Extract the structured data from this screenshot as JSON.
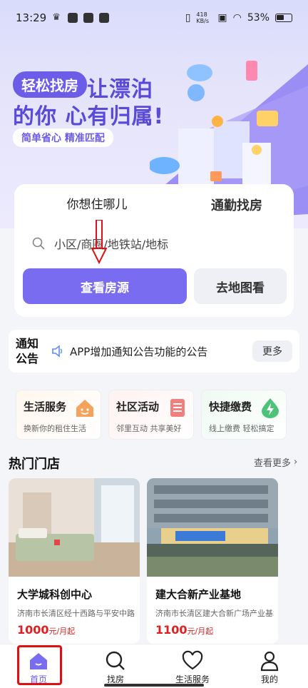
{
  "status_bar": {
    "time": "13:29",
    "net_speed": "418 KB/s",
    "battery": "53%"
  },
  "hero": {
    "pill": "轻松找房",
    "line1": "让漂泊",
    "line2": "的你 心有归属!",
    "subtitle": "简单省心 精准匹配"
  },
  "search": {
    "tab_active": "你想住哪儿",
    "tab_inactive": "通勤找房",
    "placeholder": "小区/商圈/地铁站/地标",
    "primary_button": "查看房源",
    "secondary_button": "去地图看"
  },
  "notice": {
    "label_line1": "通知",
    "label_line2": "公告",
    "text": "APP增加通知公告功能的公告",
    "more": "更多"
  },
  "services": [
    {
      "title": "生活服务",
      "subtitle": "换新你的租住生活",
      "icon": "smiley-house-icon",
      "color": "#f5a25c"
    },
    {
      "title": "社区活动",
      "subtitle": "邻里互动 共享美好",
      "icon": "list-icon",
      "color": "#f07f7f"
    },
    {
      "title": "快捷缴费",
      "subtitle": "线上缴费 轻松搞定",
      "icon": "lightning-drop-icon",
      "color": "#4fc27a"
    }
  ],
  "hot_stores": {
    "title": "热门门店",
    "more": "查看更多",
    "items": [
      {
        "name": "大学城科创中心",
        "address": "济南市长清区经十西路与平安中路",
        "price": "1000",
        "unit": "元/月起"
      },
      {
        "name": "建大合新产业基地",
        "address": "济南市长清区建大合新广场产业基地",
        "price": "1100",
        "unit": "元/月起"
      }
    ]
  },
  "bottom_nav": [
    {
      "label": "首页",
      "icon": "home-icon",
      "active": true
    },
    {
      "label": "找房",
      "icon": "search-icon",
      "active": false
    },
    {
      "label": "生活服务",
      "icon": "heart-icon",
      "active": false
    },
    {
      "label": "我的",
      "icon": "person-icon",
      "active": false
    }
  ],
  "colors": {
    "accent": "#7a6cf0",
    "price": "#e02020",
    "annotation": "#e01010"
  }
}
